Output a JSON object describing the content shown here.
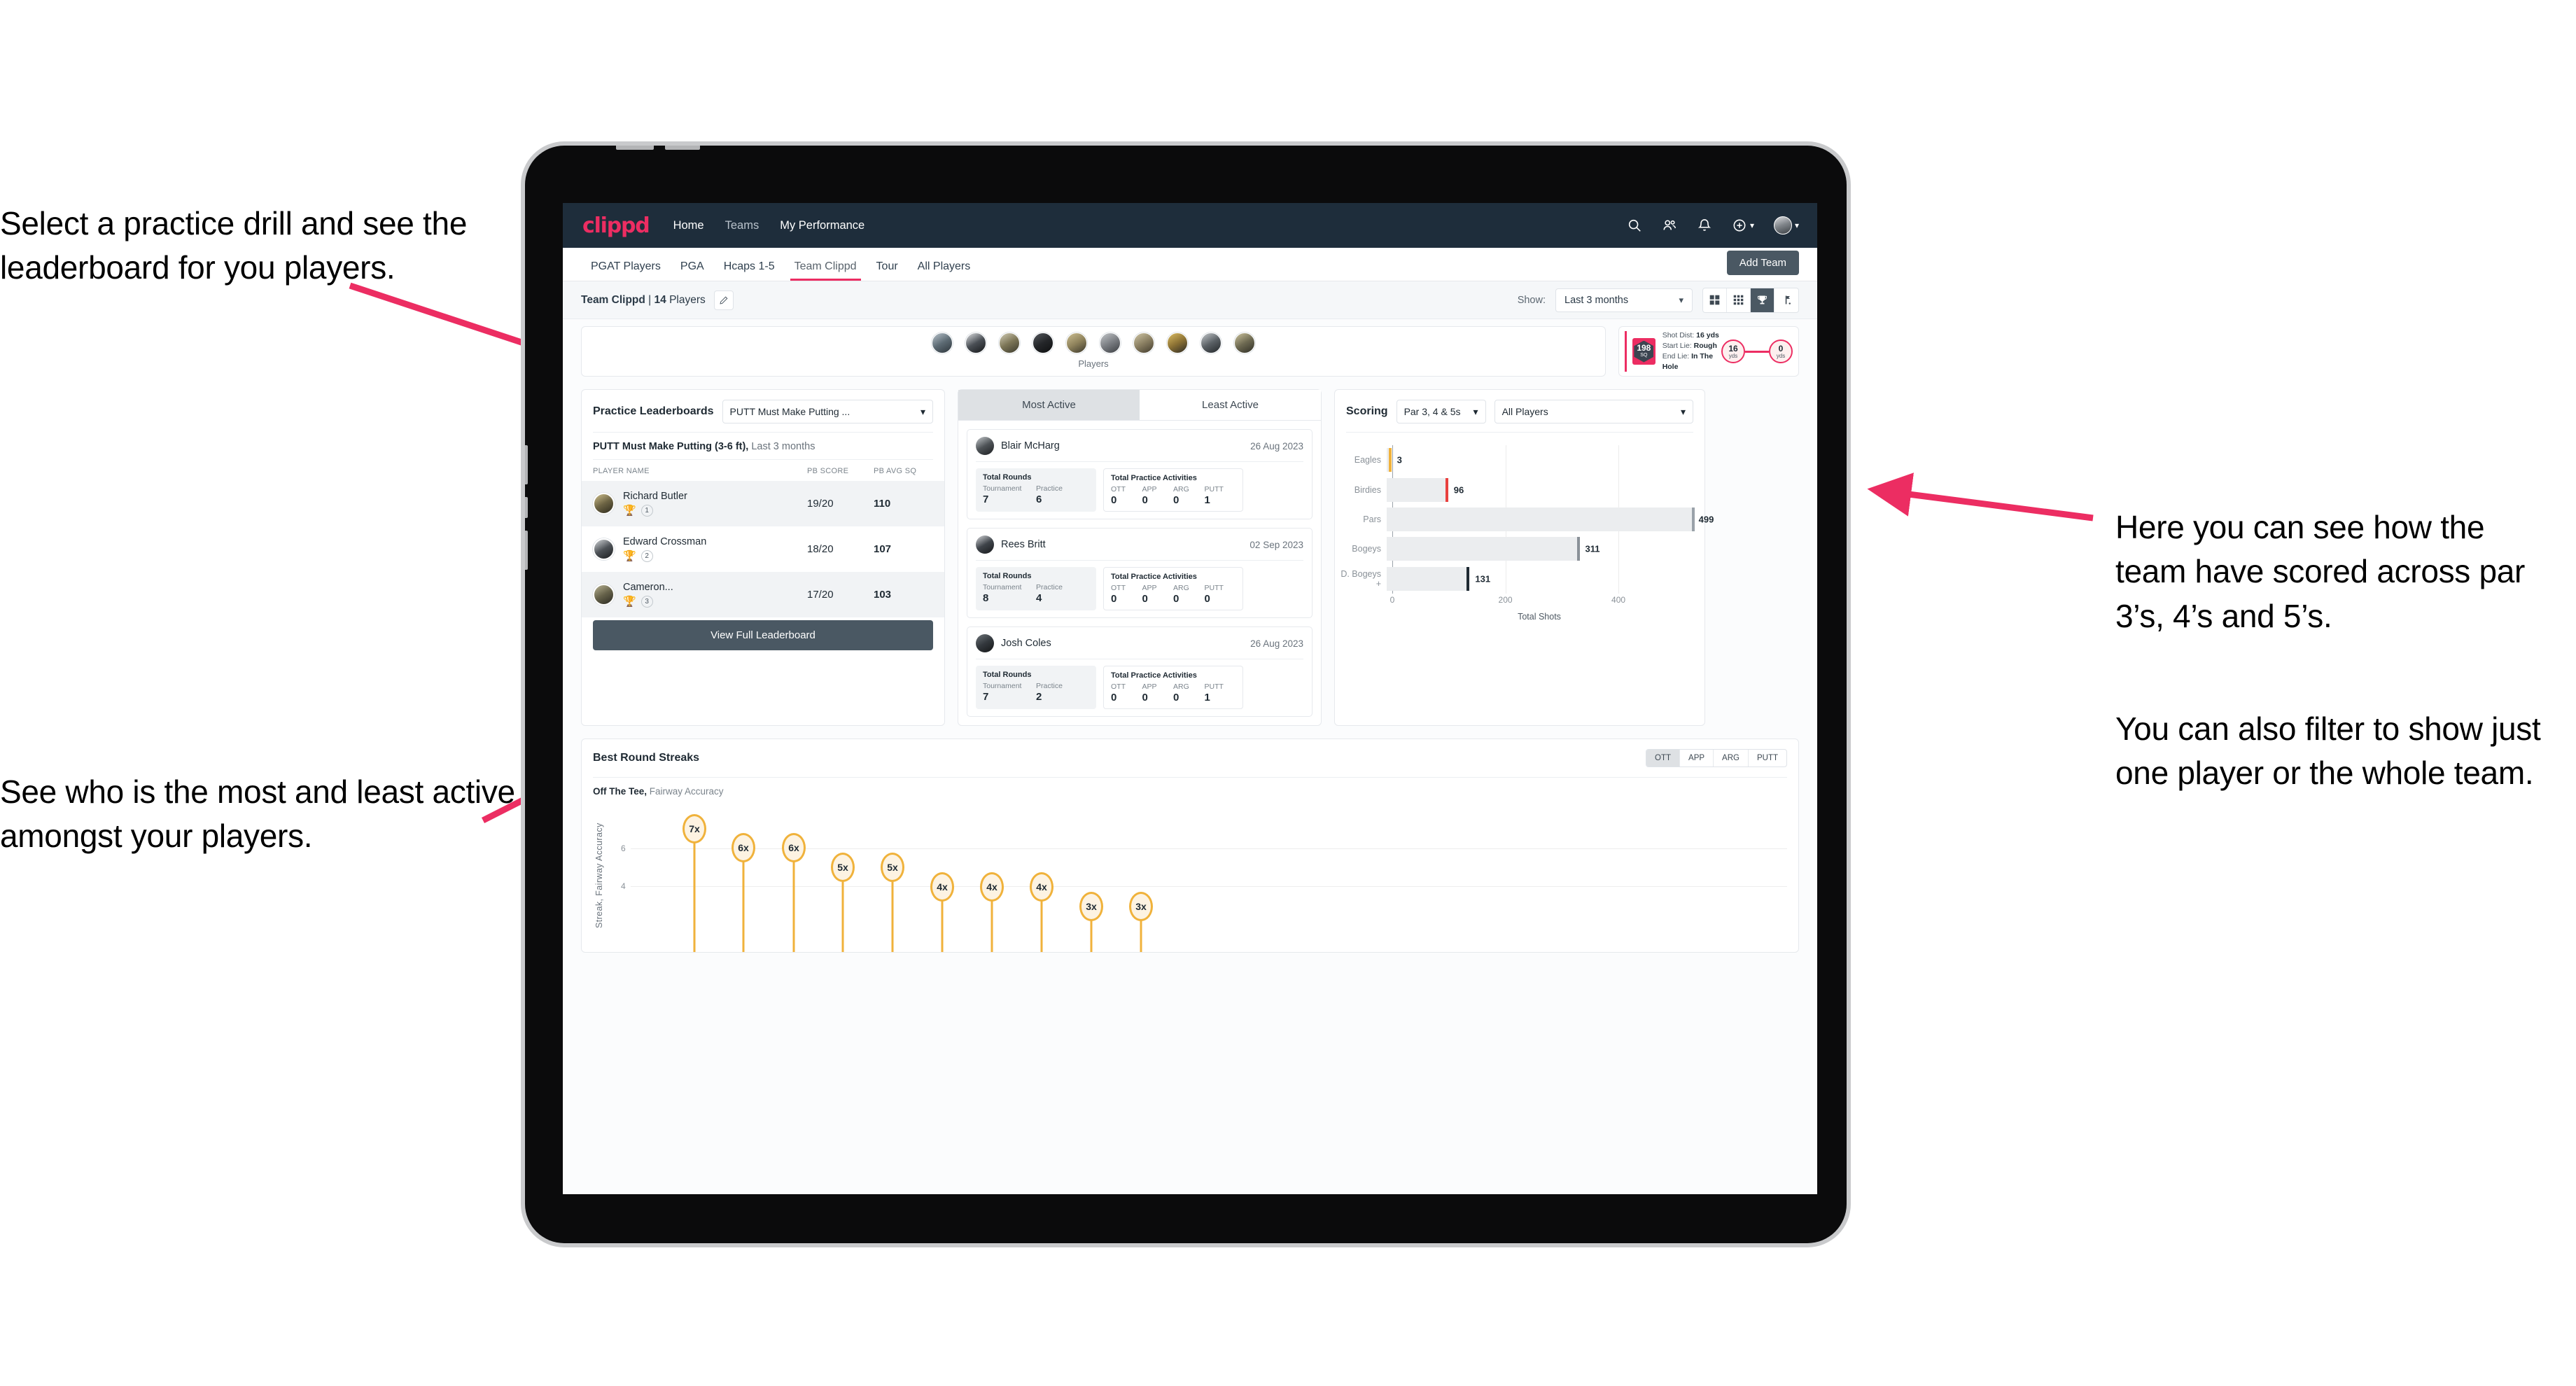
{
  "annotations": {
    "left_top": "Select a practice drill and see the leaderboard for you players.",
    "left_bottom": "See who is the most and least active amongst your players.",
    "right_top": "Here you can see how the team have scored across par 3’s, 4’s and 5’s.",
    "right_bottom": "You can also filter to show just one player or the whole team."
  },
  "navbar": {
    "brand": "clippd",
    "links": [
      {
        "label": "Home",
        "active": true
      },
      {
        "label": "Teams",
        "active": false
      },
      {
        "label": "My Performance",
        "active": true
      }
    ],
    "icons": [
      "search-icon",
      "people-icon",
      "bell-icon",
      "plus-circle-icon",
      "avatar"
    ]
  },
  "tabs": [
    {
      "label": "PGAT Players",
      "active": false
    },
    {
      "label": "PGA",
      "active": false
    },
    {
      "label": "Hcaps 1-5",
      "active": false
    },
    {
      "label": "Team Clippd",
      "active": true
    },
    {
      "label": "Tour",
      "active": false
    },
    {
      "label": "All Players",
      "active": false
    }
  ],
  "add_team_button": "Add Team",
  "subbar": {
    "team_name": "Team Clippd",
    "separator": "|",
    "player_count": "14",
    "players_word": "Players",
    "show_label": "Show:",
    "range_value": "Last 3 months",
    "view_buttons": [
      "grid-large-icon",
      "grid-small-icon",
      "trophy-icon",
      "flag-icon"
    ],
    "active_view": "trophy-icon"
  },
  "players_card": {
    "caption": "Players",
    "avatar_count": 10
  },
  "shot_card": {
    "sq_value": "198",
    "sq_unit": "SQ",
    "lines": [
      {
        "label": "Shot Dist:",
        "value": "16 yds"
      },
      {
        "label": "Start Lie:",
        "value": "Rough"
      },
      {
        "label": "End Lie:",
        "value": "In The Hole"
      }
    ],
    "start_value": "16",
    "start_unit": "yds",
    "end_value": "0",
    "end_unit": "yds"
  },
  "leaderboard": {
    "title": "Practice Leaderboards",
    "drill_select": "PUTT Must Make Putting ...",
    "subtitle_bold": "PUTT Must Make Putting (3-6 ft),",
    "subtitle_rest": " Last 3 months",
    "columns": [
      "PLAYER NAME",
      "PB SCORE",
      "PB AVG SQ"
    ],
    "rows": [
      {
        "name": "Richard Butler",
        "rank": "1",
        "score": "19/20",
        "avg_sq": "110",
        "trophy": "gold"
      },
      {
        "name": "Edward Crossman",
        "rank": "2",
        "score": "18/20",
        "avg_sq": "107",
        "trophy": "silver"
      },
      {
        "name": "Cameron...",
        "rank": "3",
        "score": "17/20",
        "avg_sq": "103",
        "trophy": "bronze"
      }
    ],
    "button": "View Full Leaderboard"
  },
  "activity": {
    "tabs": [
      {
        "label": "Most Active",
        "active": true
      },
      {
        "label": "Least Active",
        "active": false
      }
    ],
    "rounds_title": "Total Rounds",
    "rounds_keys": [
      "Tournament",
      "Practice"
    ],
    "practice_title": "Total Practice Activities",
    "practice_keys": [
      "OTT",
      "APP",
      "ARG",
      "PUTT"
    ],
    "cards": [
      {
        "name": "Blair McHarg",
        "date": "26 Aug 2023",
        "rounds": [
          "7",
          "6"
        ],
        "practice": [
          "0",
          "0",
          "0",
          "1"
        ]
      },
      {
        "name": "Rees Britt",
        "date": "02 Sep 2023",
        "rounds": [
          "8",
          "4"
        ],
        "practice": [
          "0",
          "0",
          "0",
          "0"
        ]
      },
      {
        "name": "Josh Coles",
        "date": "26 Aug 2023",
        "rounds": [
          "7",
          "2"
        ],
        "practice": [
          "0",
          "0",
          "0",
          "1"
        ]
      }
    ]
  },
  "scoring": {
    "title": "Scoring",
    "par_select": "Par 3, 4 & 5s",
    "player_select": "All Players"
  },
  "streaks": {
    "title": "Best Round Streaks",
    "segments": [
      {
        "label": "OTT",
        "active": true
      },
      {
        "label": "APP",
        "active": false
      },
      {
        "label": "ARG",
        "active": false
      },
      {
        "label": "PUTT",
        "active": false
      }
    ],
    "subtitle_bold": "Off The Tee,",
    "subtitle_rest": " Fairway Accuracy"
  },
  "chart_data": [
    {
      "type": "bar",
      "orientation": "horizontal",
      "title": "Scoring",
      "categories": [
        "Eagles",
        "Birdies",
        "Pars",
        "Bogeys",
        "D. Bogeys +"
      ],
      "values": [
        3,
        96,
        499,
        311,
        131
      ],
      "cap_colors": [
        "#f0b23b",
        "#e8413f",
        "#9aa2a9",
        "#8a9198",
        "#1f2a33"
      ],
      "xlabel": "Total Shots",
      "ylabel": "",
      "xlim": [
        0,
        520
      ],
      "xticks": [
        0,
        200,
        400
      ],
      "grid": true,
      "legend": "none"
    },
    {
      "type": "scatter",
      "subtype": "lollipop",
      "title": "Best Round Streaks",
      "series_name": "Off The Tee, Fairway Accuracy",
      "ylabel": "Streak, Fairway Accuracy",
      "yticks": [
        4,
        6
      ],
      "ylim": [
        0,
        8
      ],
      "labels": [
        "7x",
        "6x",
        "6x",
        "5x",
        "5x",
        "4x",
        "4x",
        "4x",
        "3x",
        "3x"
      ],
      "values": [
        7,
        6,
        6,
        5,
        5,
        4,
        4,
        4,
        3,
        3
      ],
      "grid": true
    }
  ]
}
